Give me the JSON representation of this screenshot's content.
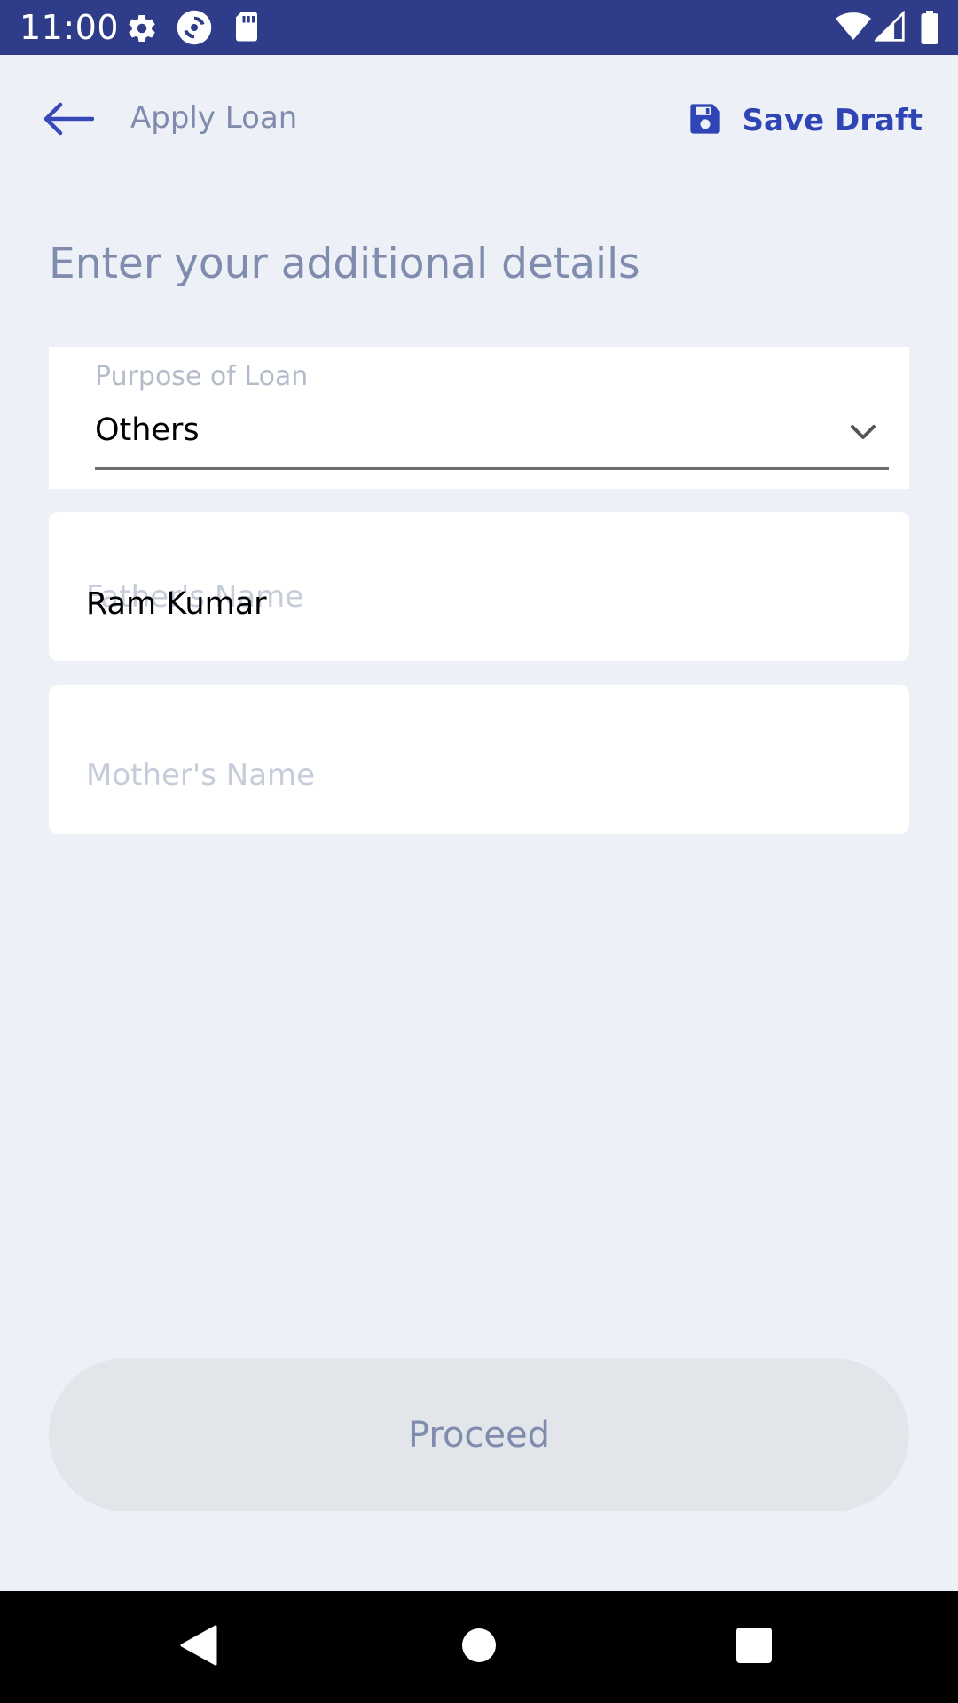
{
  "status_bar": {
    "time": "11:00",
    "icons": [
      "gear-icon",
      "sync-icon",
      "sd-card-icon",
      "wifi-icon",
      "signal-icon",
      "battery-icon"
    ]
  },
  "app_bar": {
    "back_icon": "arrow-left-icon",
    "title": "Apply Loan",
    "save_icon": "floppy-disk-icon",
    "save_label": "Save Draft"
  },
  "form": {
    "heading": "Enter your additional details",
    "purpose": {
      "label": "Purpose of Loan",
      "value": "Others",
      "icon": "chevron-down-icon"
    },
    "father_name": {
      "placeholder": "Father's Name",
      "value": "Ram Kumar"
    },
    "mother_name": {
      "placeholder": "Mother's Name",
      "value": ""
    }
  },
  "actions": {
    "proceed_label": "Proceed"
  },
  "nav_bar": {
    "icons": [
      "back-triangle-icon",
      "home-circle-icon",
      "recents-square-icon"
    ]
  },
  "colors": {
    "status_bar": "#2F3C8A",
    "accent": "#2F45B5",
    "background": "#EDF0F7",
    "muted_text": "#7F8CAD",
    "placeholder": "#C6CCD9",
    "button_disabled": "#E2E5EA"
  }
}
